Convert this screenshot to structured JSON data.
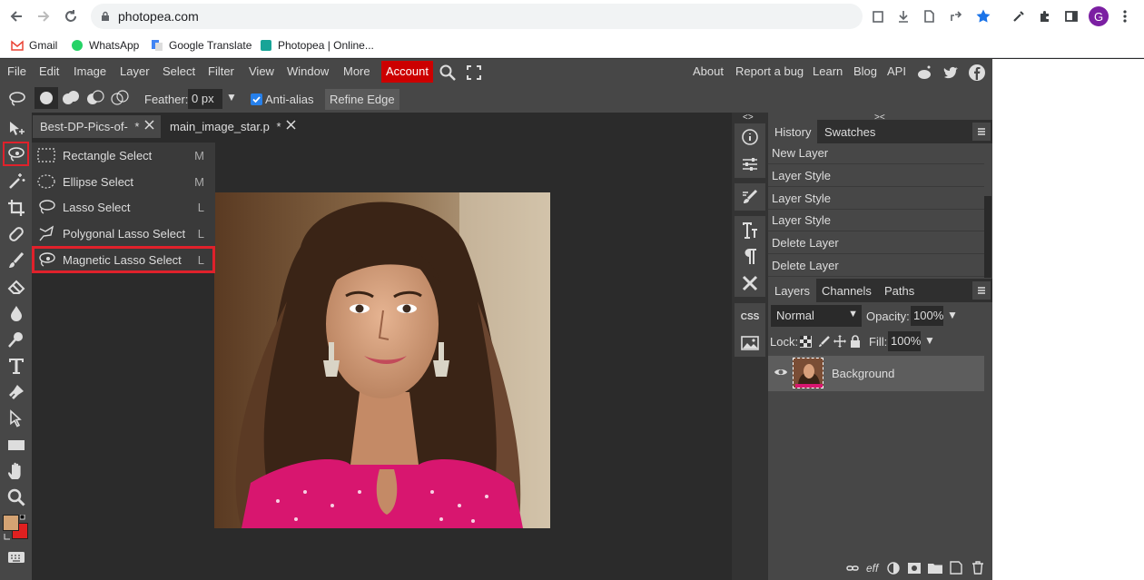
{
  "browser": {
    "url": "photopea.com",
    "profile_initial": "G",
    "bookmarks": [
      "Gmail",
      "WhatsApp",
      "Google Translate",
      "Photopea | Online..."
    ]
  },
  "menubar": {
    "items": [
      "File",
      "Edit",
      "Image",
      "Layer",
      "Select",
      "Filter",
      "View",
      "Window",
      "More"
    ],
    "account": "Account",
    "right_links": [
      "About",
      "Report a bug",
      "Learn",
      "Blog",
      "API"
    ]
  },
  "options": {
    "feather_label": "Feather:",
    "feather_value": "0 px",
    "antialias_label": "Anti-alias",
    "refine_edge": "Refine Edge"
  },
  "tabs": [
    {
      "label": "Best-DP-Pics-of-",
      "modified": "*"
    },
    {
      "label": "main_image_star.p",
      "modified": "*"
    }
  ],
  "tool_flyout": [
    {
      "label": "Rectangle Select",
      "shortcut": "M",
      "icon": "rect-select-icon"
    },
    {
      "label": "Ellipse Select",
      "shortcut": "M",
      "icon": "ellipse-select-icon"
    },
    {
      "label": "Lasso Select",
      "shortcut": "L",
      "icon": "lasso-icon"
    },
    {
      "label": "Polygonal Lasso Select",
      "shortcut": "L",
      "icon": "polygonal-lasso-icon"
    },
    {
      "label": "Magnetic Lasso Select",
      "shortcut": "L",
      "icon": "magnetic-lasso-icon",
      "highlighted": true
    }
  ],
  "history": {
    "tabs": [
      "History",
      "Swatches"
    ],
    "items": [
      "New Layer",
      "Layer Style",
      "Layer Style",
      "Layer Style",
      "Delete Layer",
      "Delete Layer"
    ]
  },
  "layers": {
    "tabs": [
      "Layers",
      "Channels",
      "Paths"
    ],
    "blend_mode": "Normal",
    "opacity_label": "Opacity:",
    "opacity": "100%",
    "lock_label": "Lock:",
    "fill_label": "Fill:",
    "fill": "100%",
    "layer_name": "Background"
  },
  "side_icons": {
    "css": "CSS"
  },
  "colors": {
    "accent_red": "#cc0000",
    "highlight_box": "#e0212b",
    "foreground": "#d4a373",
    "background": "#e02020"
  }
}
